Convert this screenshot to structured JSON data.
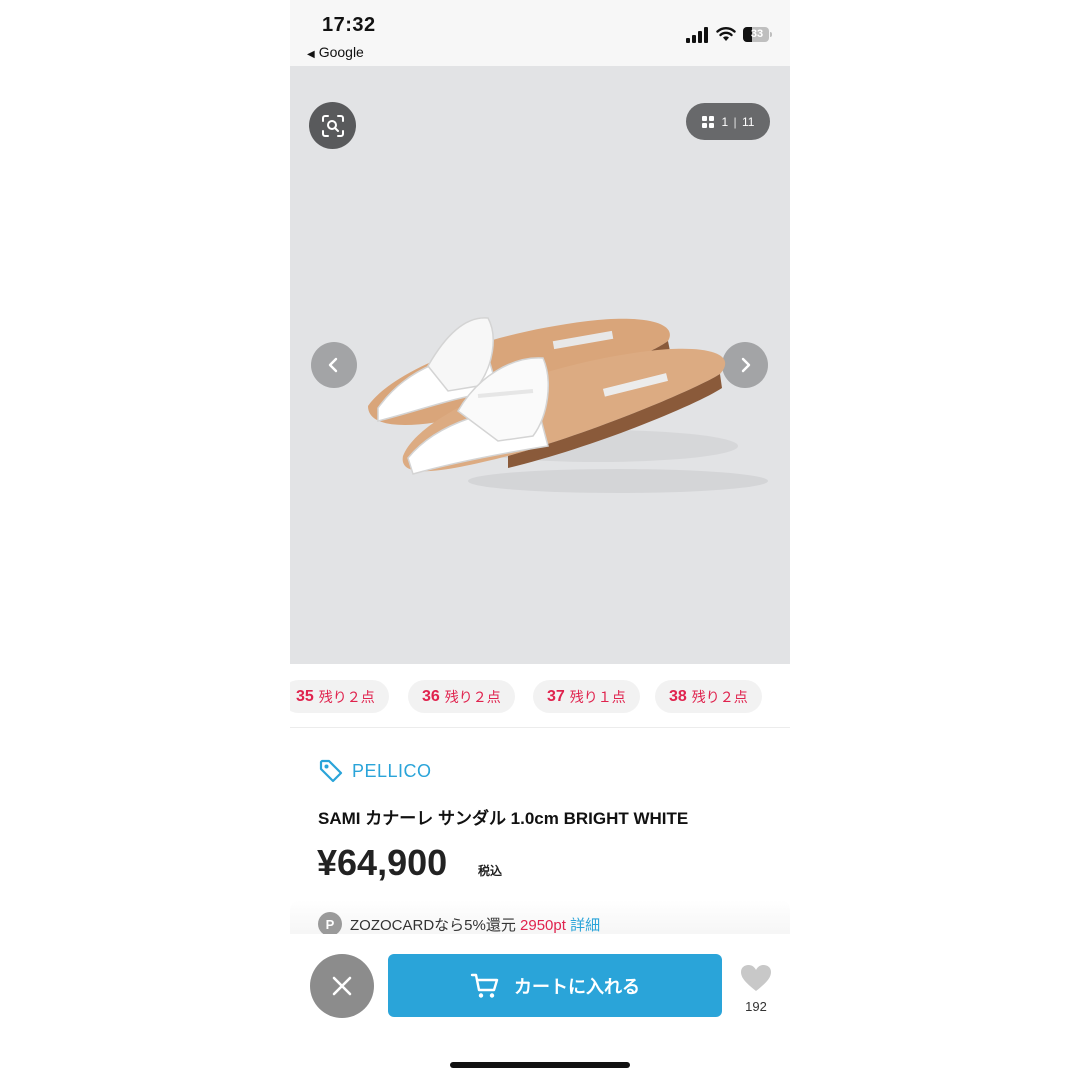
{
  "status_bar": {
    "time": "17:32",
    "back_label": "Google",
    "battery": "33"
  },
  "gallery": {
    "current": "1",
    "separator": "|",
    "total": "11",
    "icons": [
      "visual-search-icon",
      "grid-icon",
      "chevron-left-icon",
      "chevron-right-icon"
    ],
    "background": "#e2e3e5"
  },
  "sizes": [
    {
      "size": "35",
      "stock": "残り２点"
    },
    {
      "size": "36",
      "stock": "残り２点"
    },
    {
      "size": "37",
      "stock": "残り１点"
    },
    {
      "size": "38",
      "stock": "残り２点"
    }
  ],
  "product": {
    "brand": "PELLICO",
    "title": "SAMI カナーレ サンダル 1.0cm BRIGHT WHITE",
    "price": "¥64,900",
    "tax_label": "税込"
  },
  "promo": {
    "badge": "P",
    "text": "ZOZOCARDなら5%還元",
    "points": "2950pt",
    "detail_link": "詳細"
  },
  "actions": {
    "cart_label": "カートに入れる",
    "favorite_count": "192"
  },
  "colors": {
    "accent": "#2aa4d9",
    "sale_red": "#e0234e",
    "close_button": "#8c8c8c"
  }
}
